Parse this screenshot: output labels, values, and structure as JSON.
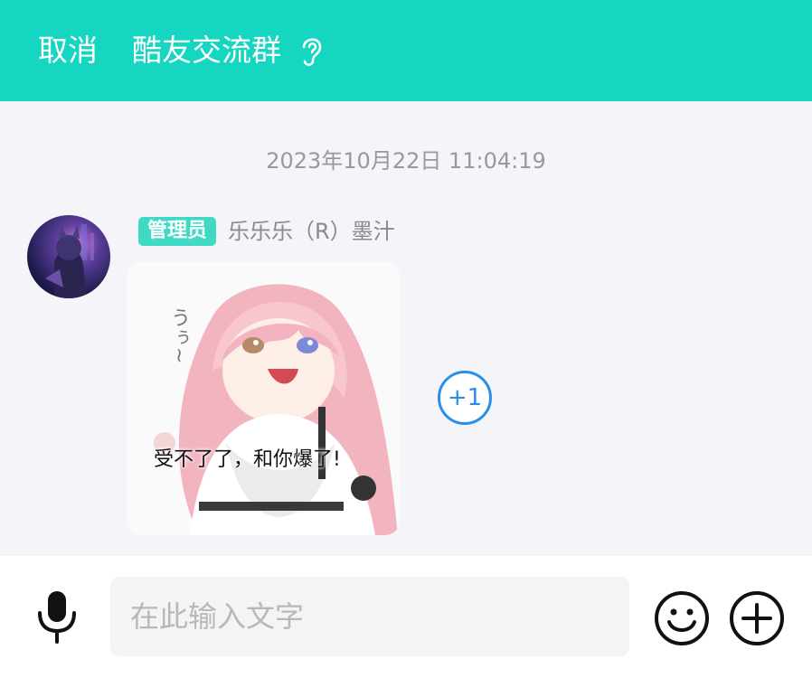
{
  "header": {
    "cancel_label": "取消",
    "title": "酷友交流群",
    "ear_icon": "ear-icon",
    "background_color": "#15d6c0"
  },
  "chat": {
    "timestamp": "2023年10月22日 11:04:19",
    "messages": [
      {
        "badge": "管理员",
        "sender": "乐乐乐（R）墨汁",
        "sticker_caption": "受不了了，和你爆了!",
        "sticker_squiggle": "うぅ~",
        "plus_one_label": "+1"
      }
    ]
  },
  "input_bar": {
    "placeholder": "在此输入文字",
    "mic_icon": "mic-icon",
    "emoji_icon": "emoji-icon",
    "add_icon": "add-icon"
  },
  "colors": {
    "accent": "#15d6c0",
    "badge": "#3fd9c4",
    "plus_one": "#2b8de8"
  }
}
